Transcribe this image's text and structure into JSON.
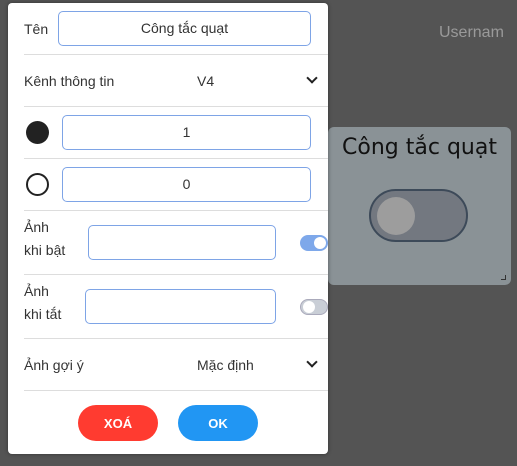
{
  "header": {
    "username": "Usernam"
  },
  "card": {
    "title": "Công tắc quạt"
  },
  "panel": {
    "name_label": "Tên",
    "name_value": "Công tắc quạt",
    "channel_label": "Kênh thông tin",
    "channel_value": "V4",
    "on_value": "1",
    "off_value": "0",
    "image_on_label_1": "Ảnh",
    "image_on_label_2": "khi bật",
    "image_on_value": "",
    "image_on_toggle": true,
    "image_off_label_1": "Ảnh",
    "image_off_label_2": "khi tắt",
    "image_off_value": "",
    "image_off_toggle": false,
    "suggest_label": "Ảnh gợi ý",
    "suggest_value": "Mặc định",
    "delete_label": "XOÁ",
    "ok_label": "OK"
  },
  "colors": {
    "delete": "#ff3b30",
    "ok": "#2196f3",
    "toggle_on": "#7ea8ea",
    "toggle_off": "#c9ced6"
  }
}
